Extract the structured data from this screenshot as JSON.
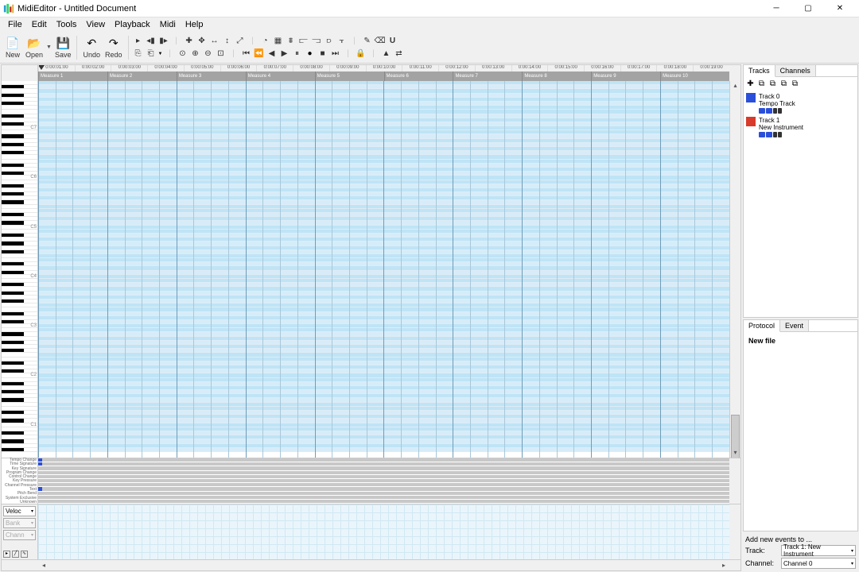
{
  "app": {
    "title": "MidiEditor - Untitled Document"
  },
  "menu": [
    "File",
    "Edit",
    "Tools",
    "View",
    "Playback",
    "Midi",
    "Help"
  ],
  "toolbar_main": [
    {
      "label": "New"
    },
    {
      "label": "Open"
    },
    {
      "label": "Save"
    },
    {
      "label": "Undo"
    },
    {
      "label": "Redo"
    }
  ],
  "timeline": {
    "times": [
      "0:00:01:00",
      "0:00:02:00",
      "0:00:03:00",
      "0:00:04:00",
      "0:00:05:00",
      "0:00:06:00",
      "0:00:07:00",
      "0:00:08:00",
      "0:00:09:00",
      "0:00:10:00",
      "0:00:11:00",
      "0:00:12:00",
      "0:00:13:00",
      "0:00:14:00",
      "0:00:15:00",
      "0:00:16:00",
      "0:00:17:00",
      "0:00:18:00",
      "0:00:19:00"
    ],
    "measures": [
      "Measure 1",
      "Measure 2",
      "Measure 3",
      "Measure 4",
      "Measure 5",
      "Measure 6",
      "Measure 7",
      "Measure 8",
      "Measure 9",
      "Measure 10"
    ]
  },
  "event_lanes": [
    "Tempo Change",
    "Time Signature",
    "Key Signature",
    "Program Change",
    "Control Change",
    "Key Pressure",
    "Channel Pressure",
    "Text",
    "Pitch Bend",
    "System Exclusive",
    "Unknown"
  ],
  "velocity": {
    "selectors": [
      {
        "label": "Veloc",
        "enabled": true
      },
      {
        "label": "Bank",
        "enabled": false
      },
      {
        "label": "Chann",
        "enabled": false
      }
    ]
  },
  "tracks_panel": {
    "tabs": [
      "Tracks",
      "Channels"
    ],
    "tracks": [
      {
        "name": "Track 0",
        "sub": "Tempo Track",
        "color": "#2b4fd8"
      },
      {
        "name": "Track 1",
        "sub": "New Instrument",
        "color": "#d83a2b"
      }
    ]
  },
  "protocol_panel": {
    "tabs": [
      "Protocol",
      "Event"
    ],
    "entries": [
      "New file"
    ]
  },
  "bottom": {
    "heading": "Add new events to ...",
    "track_label": "Track:",
    "track_value": "Track 1: New Instrument",
    "channel_label": "Channel:",
    "channel_value": "Channel 0"
  }
}
